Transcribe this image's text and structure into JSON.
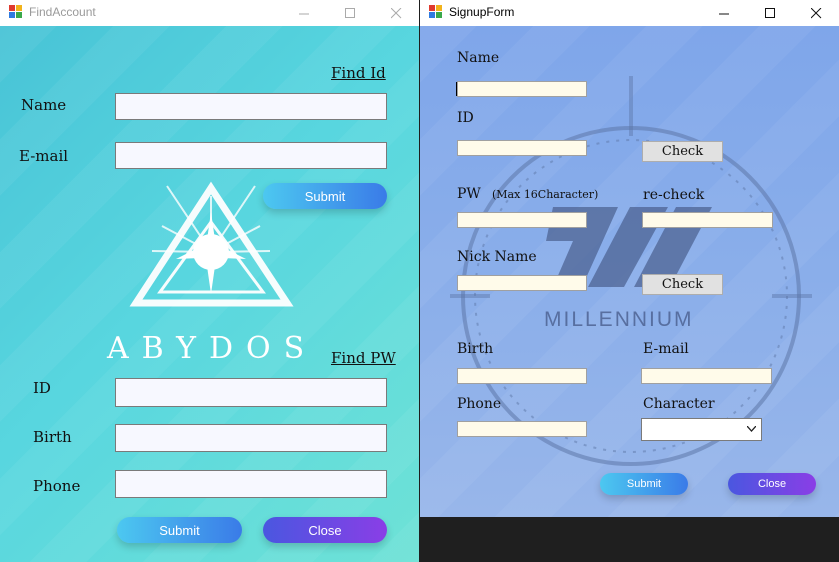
{
  "find_account": {
    "title": "FindAccount",
    "find_id_link": "Find Id",
    "name_label": "Name",
    "email_label": "E-mail",
    "submit_top": "Submit",
    "logo_text": "ABYDOS",
    "find_pw_link": "Find PW",
    "id_label": "ID",
    "birth_label": "Birth",
    "phone_label": "Phone",
    "submit_bottom": "Submit",
    "close": "Close"
  },
  "signup": {
    "title": "SignupForm",
    "name_label": "Name",
    "id_label": "ID",
    "check1": "Check",
    "pw_label": "PW",
    "pw_hint": "(Max 16Character)",
    "recheck_label": "re-check",
    "nick_label": "Nick Name",
    "check2": "Check",
    "logo_text": "MILLENNIUM",
    "birth_label": "Birth",
    "email_label": "E-mail",
    "phone_label": "Phone",
    "character_label": "Character",
    "submit": "Submit",
    "close": "Close"
  }
}
